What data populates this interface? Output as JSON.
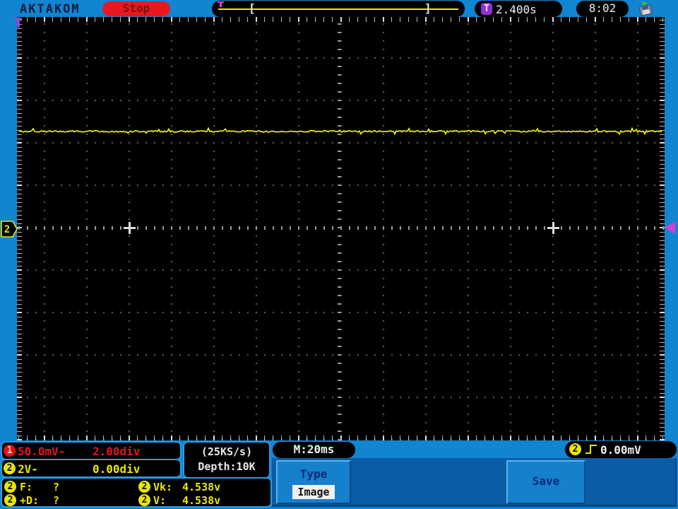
{
  "topbar": {
    "brand": "AKTAKOM",
    "run_state": "Stop",
    "bracket_left": "[",
    "bracket_right": "]",
    "trigger_badge": "T",
    "trigger_time": "2.400s",
    "clock": "8:02"
  },
  "grid": {
    "trigger_corner_marker": "T",
    "ch2_marker": "2",
    "trace": {
      "channel": 2,
      "color": "#f8f800",
      "level_volts": 4.538,
      "divisions_above_center": 2.27
    }
  },
  "bottom": {
    "ch1": {
      "badge": "1",
      "scale": "50.0mV-",
      "offset": "2.00div"
    },
    "ch2": {
      "badge": "2",
      "scale": "2V-",
      "offset": "0.00div"
    },
    "acquisition": {
      "sample_rate": "(25KS/s)",
      "depth": "Depth:10K"
    },
    "timebase": "M:20ms",
    "trigger_level": {
      "badge": "2",
      "value": "0.00mV"
    },
    "measurements": {
      "rows": [
        {
          "badge_a": "2",
          "label_a": "F:",
          "value_a": "?",
          "badge_b": "2",
          "label_b": "Vk:",
          "value_b": "4.538v"
        },
        {
          "badge_a": "2",
          "label_a": "+D:",
          "value_a": "?",
          "badge_b": "2",
          "label_b": "V:",
          "value_b": "4.538v"
        }
      ]
    },
    "menu": {
      "type_label": "Type",
      "type_value": "Image",
      "save_label": "Save"
    }
  },
  "colors": {
    "chrome_blue": "#1184d2",
    "menu_blue": "#0a5ca6",
    "button_blue": "#1580cc",
    "accent_border": "#2e9ae0",
    "ch1_red": "#e01818",
    "ch2_yellow": "#e8e800",
    "trace_yellow": "#f8f800",
    "trigger_purple": "#9030d0",
    "marker_magenta": "#d040d0",
    "stop_red": "#e81820"
  }
}
